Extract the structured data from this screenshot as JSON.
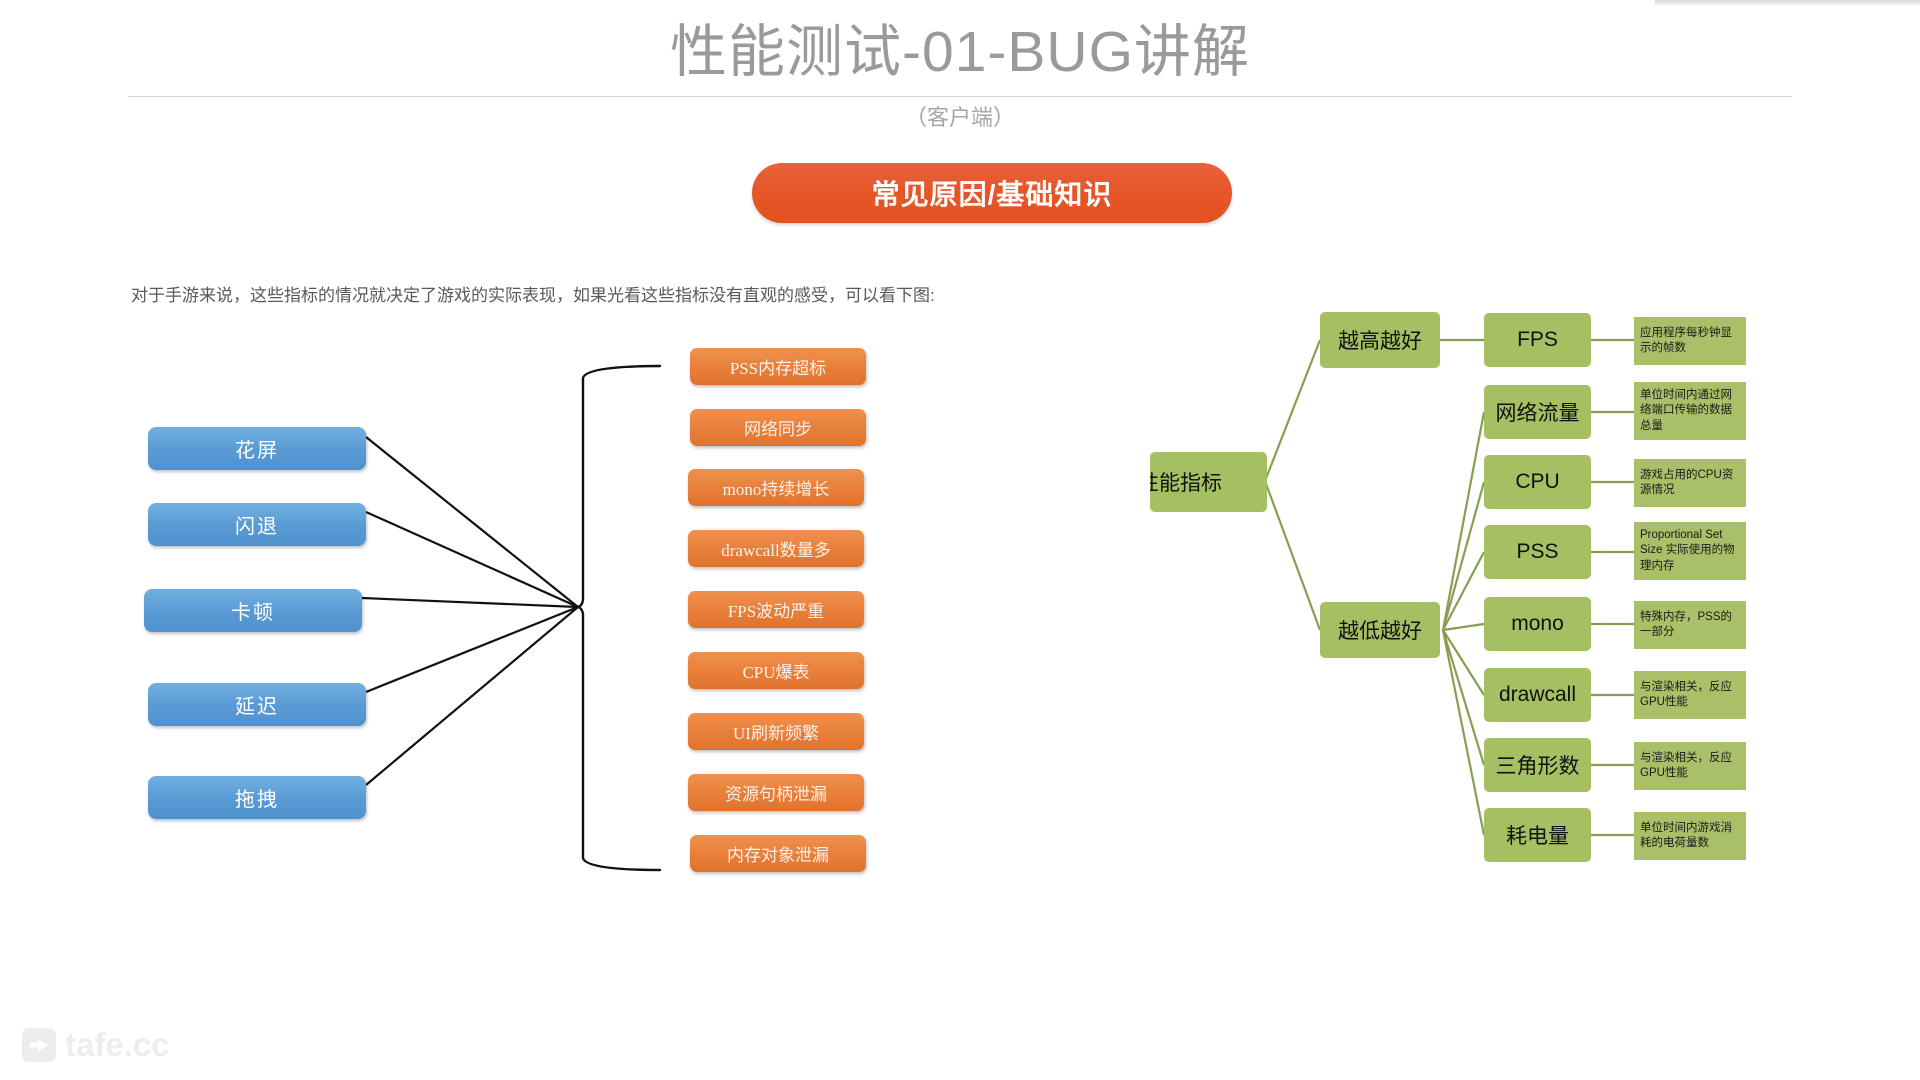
{
  "slide": {
    "title": "性能测试-01-BUG讲解",
    "subtitle": "（客户端）",
    "banner_label": "常见原因/基础知识",
    "lead_text": "对于手游来说，这些指标的情况就决定了游戏的实际表现，如果光看这些指标没有直观的感受，可以看下图:",
    "watermark": "tafe.cc"
  },
  "colors": {
    "banner_orange": "#e4511f",
    "blue_node": "#5b9bd5",
    "orange_node": "#e8803c",
    "green_node": "#a5bf63",
    "green_desc": "#a9c068",
    "title_gray": "#9a9a9a"
  },
  "symptoms": [
    {
      "label": "花屏"
    },
    {
      "label": "闪退"
    },
    {
      "label": "卡顿"
    },
    {
      "label": "延迟"
    },
    {
      "label": "拖拽"
    }
  ],
  "causes": [
    {
      "label": "PSS内存超标"
    },
    {
      "label": "网络同步"
    },
    {
      "label": "mono持续增长"
    },
    {
      "label": "drawcall数量多"
    },
    {
      "label": "FPS波动严重"
    },
    {
      "label": "CPU爆表"
    },
    {
      "label": "UI刷新频繁"
    },
    {
      "label": "资源句柄泄漏"
    },
    {
      "label": "内存对象泄漏"
    }
  ],
  "metrics_tree": {
    "root": "性能指标",
    "branches": [
      {
        "label": "越高越好"
      },
      {
        "label": "越低越好"
      }
    ],
    "metrics": [
      {
        "label": "FPS",
        "desc": "应用程序每秒钟显示的帧数",
        "branch": "越高越好"
      },
      {
        "label": "网络流量",
        "desc": "单位时间内通过网络端口传输的数据总量",
        "branch": "越低越好"
      },
      {
        "label": "CPU",
        "desc": "游戏占用的CPU资源情况",
        "branch": "越低越好"
      },
      {
        "label": "PSS",
        "desc": "Proportional Set Size 实际使用的物理内存",
        "branch": "越低越好"
      },
      {
        "label": "mono",
        "desc": "特殊内存，PSS的一部分",
        "branch": "越低越好"
      },
      {
        "label": "drawcall",
        "desc": "与渲染相关，反应GPU性能",
        "branch": "越低越好"
      },
      {
        "label": "三角形数",
        "desc": "与渲染相关，反应GPU性能",
        "branch": "越低越好"
      },
      {
        "label": "耗电量",
        "desc": "单位时间内游戏消耗的电荷量数",
        "branch": "越低越好"
      }
    ]
  }
}
